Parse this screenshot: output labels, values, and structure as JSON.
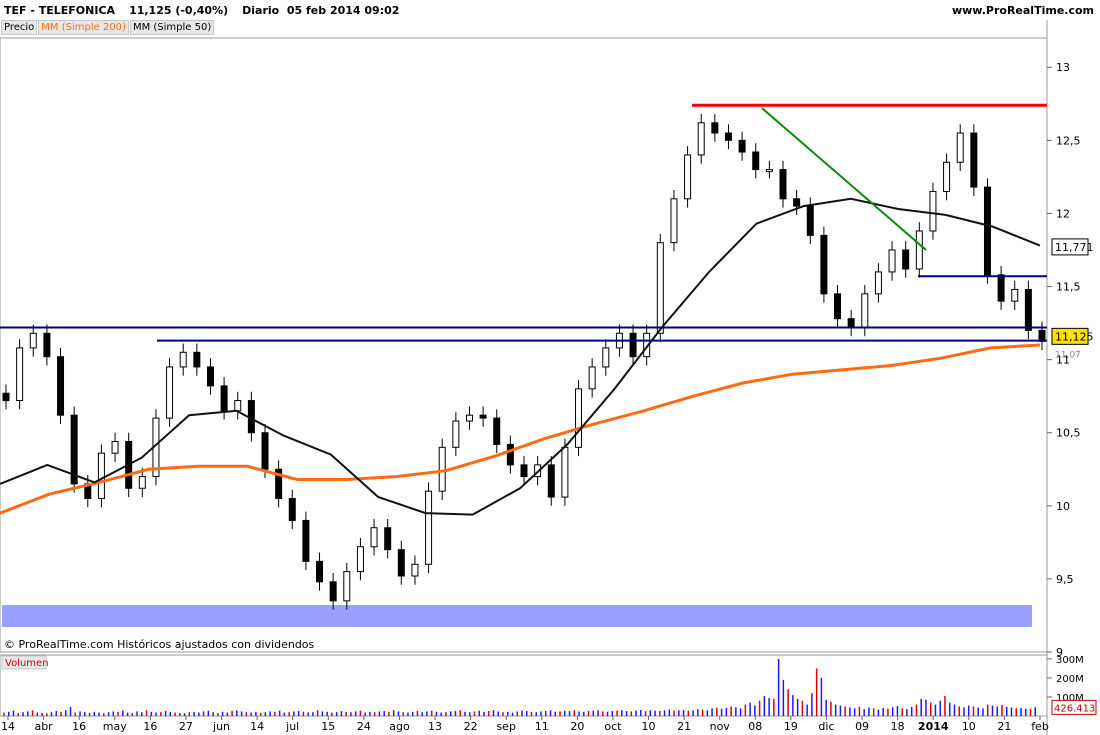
{
  "header": {
    "ticker": "TEF - TELEFONICA",
    "price_change": "11,125 (-0,40%)",
    "period": "Diario  05 feb 2014 09:02",
    "site": "www.ProRealTime.com"
  },
  "legend": {
    "price": "Precio",
    "ma200": "MM (Simple 200)",
    "ma50": "MM (Simple 50)"
  },
  "footer": {
    "copyright": "© ProRealTime.com  Históricos ajustados con dividendos"
  },
  "volume_panel": {
    "title": "Volumen"
  },
  "colors": {
    "ma200": "#ff6a13",
    "ma50": "#111111",
    "resistance": "#ff0000",
    "trendline": "#0a8a0a",
    "support": "#000080",
    "band": "#9aa0ff",
    "vol_up": "#1a1aff",
    "vol_down": "#e00000"
  },
  "price_labels": {
    "current": "11,125",
    "ma50": "11,771",
    "hidden": "11,07"
  },
  "volume_labels": {
    "current": "426.413"
  },
  "chart_data": [
    {
      "type": "candlestick",
      "title": "TEF - TELEFONICA",
      "ylim": [
        9,
        13.2
      ],
      "yticks": [
        "9",
        "9,5",
        "10",
        "10,5",
        "11",
        "11,5",
        "12",
        "12,5",
        "13"
      ],
      "ytick_values": [
        9,
        9.5,
        10,
        10.5,
        11,
        11.5,
        12,
        12.5,
        13
      ],
      "xticks": [
        "14",
        "abr",
        "16",
        "may",
        "16",
        "27",
        "jun",
        "14",
        "jul",
        "15",
        "24",
        "ago",
        "13",
        "22",
        "sep",
        "11",
        "20",
        "oct",
        "10",
        "21",
        "nov",
        "08",
        "19",
        "dic",
        "09",
        "18",
        "2014",
        "10",
        "21",
        "feb"
      ],
      "x_range_dates": [
        "2013-03-14",
        "2014-02-05"
      ],
      "close_series": [
        10.72,
        11.08,
        11.18,
        11.02,
        10.62,
        10.15,
        10.05,
        10.36,
        10.44,
        10.12,
        10.2,
        10.6,
        10.95,
        11.05,
        10.95,
        10.82,
        10.65,
        10.72,
        10.5,
        10.25,
        10.05,
        9.9,
        9.62,
        9.48,
        9.35,
        9.55,
        9.72,
        9.85,
        9.7,
        9.52,
        9.6,
        10.1,
        10.4,
        10.58,
        10.62,
        10.6,
        10.42,
        10.28,
        10.2,
        10.28,
        10.06,
        10.4,
        10.8,
        10.95,
        11.08,
        11.18,
        11.02,
        11.18,
        11.8,
        12.1,
        12.4,
        12.62,
        12.55,
        12.5,
        12.42,
        12.3,
        12.3,
        12.1,
        12.05,
        11.85,
        11.45,
        11.28,
        11.22,
        11.45,
        11.6,
        11.75,
        11.62,
        11.88,
        12.15,
        12.35,
        12.55,
        12.18,
        11.58,
        11.4,
        11.48,
        11.2,
        11.125
      ],
      "series": [
        {
          "name": "MM (Simple 200)",
          "values": [
            9.95,
            10.08,
            10.16,
            10.25,
            10.27,
            10.27,
            10.18,
            10.18,
            10.2,
            10.24,
            10.34,
            10.46,
            10.56,
            10.65,
            10.75,
            10.84,
            10.9,
            10.93,
            10.96,
            11.01,
            11.08,
            11.1
          ]
        },
        {
          "name": "MM (Simple 50)",
          "values": [
            10.15,
            10.28,
            10.16,
            10.33,
            10.62,
            10.65,
            10.48,
            10.35,
            10.06,
            9.95,
            9.94,
            10.12,
            10.42,
            10.8,
            11.22,
            11.6,
            11.93,
            12.05,
            12.1,
            12.03,
            11.99,
            11.91,
            11.78
          ]
        }
      ],
      "lines": [
        {
          "name": "resistance",
          "y": 12.74
        },
        {
          "name": "support-upper",
          "y": 11.22
        },
        {
          "name": "support-lower",
          "y": 11.13
        },
        {
          "name": "support-short",
          "y": 11.57
        },
        {
          "name": "trendline",
          "from": 12.72,
          "to": 11.75
        }
      ],
      "band": [
        9.2,
        9.28
      ]
    },
    {
      "type": "bar",
      "title": "Volumen",
      "yticks": [
        "100M",
        "200M",
        "300M"
      ],
      "ylim": [
        0,
        310
      ],
      "values": [
        18,
        22,
        28,
        15,
        20,
        24,
        30,
        18,
        16,
        14,
        20,
        26,
        22,
        30,
        48,
        18,
        24,
        20,
        16,
        22,
        18,
        14,
        20,
        24,
        22,
        28,
        18,
        16,
        24,
        20,
        30,
        22,
        18,
        20,
        26,
        22,
        18,
        16,
        14,
        20,
        22,
        18,
        24,
        28,
        20,
        16,
        22,
        18,
        26,
        30,
        24,
        20,
        18,
        22,
        16,
        20,
        24,
        22,
        28,
        18,
        20,
        24,
        26,
        22,
        18,
        20,
        30,
        24,
        22,
        18,
        20,
        26,
        22,
        20,
        24,
        28,
        18,
        22,
        20,
        24,
        26,
        22,
        30,
        24,
        20,
        18,
        22,
        26,
        20,
        24,
        28,
        22,
        18,
        20,
        24,
        26,
        30,
        22,
        20,
        24,
        28,
        22,
        26,
        30,
        24,
        20,
        22,
        18,
        24,
        28,
        26,
        22,
        20,
        24,
        26,
        30,
        22,
        24,
        28,
        26,
        30,
        24,
        22,
        26,
        28,
        30,
        24,
        22,
        26,
        28,
        30,
        26,
        24,
        28,
        32,
        26,
        30,
        28,
        26,
        30,
        34,
        28,
        30,
        32,
        28,
        30,
        36,
        34,
        30,
        40,
        44,
        38,
        42,
        50,
        46,
        40,
        60,
        70,
        55,
        80,
        105,
        95,
        90,
        300,
        190,
        140,
        110,
        90,
        80,
        60,
        120,
        250,
        200,
        85,
        75,
        60,
        55,
        50,
        45,
        40,
        48,
        36,
        44,
        40,
        34,
        42,
        38,
        46,
        52,
        40,
        36,
        48,
        60,
        90,
        85,
        70,
        60,
        80,
        105,
        70,
        60,
        50,
        45,
        55,
        50,
        45,
        40,
        60,
        55,
        50,
        58,
        48,
        44,
        40,
        42,
        38,
        36,
        46
      ]
    }
  ]
}
